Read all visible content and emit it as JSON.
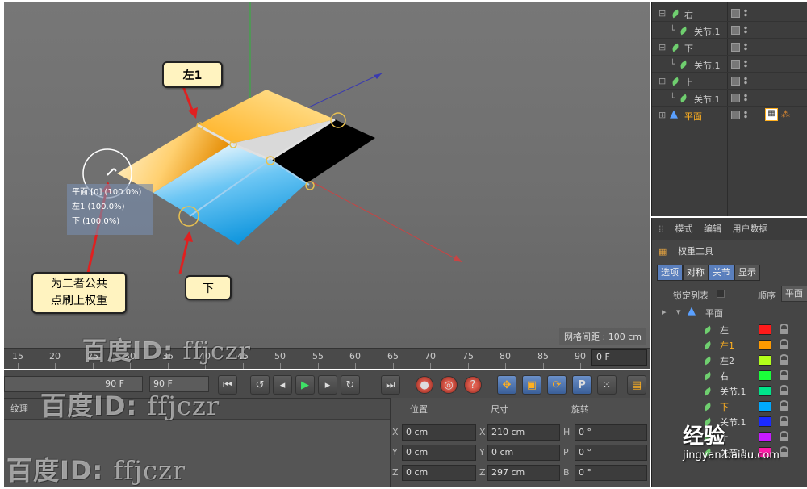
{
  "viewport": {
    "callout_left1": "左1",
    "callout_bottom": "下",
    "callout_note_line1": "为二者公共",
    "callout_note_line2": "点刷上权重",
    "tooltip_lines": [
      "平面.[0] (100.0%)",
      "左1 (100.0%)",
      "下 (100.0%)"
    ],
    "grid_spacing": "网格间距 : 100 cm"
  },
  "timeline": {
    "ticks": [
      "15",
      "20",
      "25",
      "30",
      "35",
      "40",
      "45",
      "50",
      "55",
      "60",
      "65",
      "70",
      "75",
      "80",
      "85",
      "90"
    ],
    "frame": "0 F"
  },
  "transport": {
    "end_frame_field": "90 F",
    "max_frame_field": "90 F",
    "buttons": [
      "go-to-start",
      "rewind",
      "step-back",
      "play",
      "step-forward",
      "go-to-end",
      "loop"
    ],
    "record_buttons": [
      "record-keyframe",
      "auto-keyframe",
      "keyframe-selection"
    ],
    "key_buttons": [
      "move-key",
      "scale-key",
      "rotate-key",
      "param-key",
      "point-level"
    ]
  },
  "bottom_left": {
    "tab": "纹理"
  },
  "coords": {
    "head_position": "位置",
    "head_size": "尺寸",
    "head_rotation": "旋转",
    "rows": [
      {
        "axis": "X",
        "pos": "0 cm",
        "size_axis": "X",
        "size": "210 cm",
        "rot_axis": "H",
        "rot": "0 °"
      },
      {
        "axis": "Y",
        "pos": "0 cm",
        "size_axis": "Y",
        "size": "0 cm",
        "rot_axis": "P",
        "rot": "0 °"
      },
      {
        "axis": "Z",
        "pos": "0 cm",
        "size_axis": "Z",
        "size": "297 cm",
        "rot_axis": "B",
        "rot": "0 °"
      }
    ]
  },
  "object_manager": {
    "rows": [
      {
        "name": "右",
        "type": "joint"
      },
      {
        "name": "关节.1",
        "type": "joint-child"
      },
      {
        "name": "下",
        "type": "joint"
      },
      {
        "name": "关节.1",
        "type": "joint-child"
      },
      {
        "name": "上",
        "type": "joint"
      },
      {
        "name": "关节.1",
        "type": "joint-child"
      },
      {
        "name": "平面",
        "type": "plane"
      }
    ]
  },
  "attributes": {
    "menu": [
      "模式",
      "编辑",
      "用户数据"
    ],
    "title": "权重工具",
    "tabs": [
      "选项",
      "对称",
      "关节",
      "显示"
    ],
    "lock_list_label": "锁定列表",
    "order_label": "顺序",
    "order_value": "平面",
    "root": "平面",
    "weights": [
      {
        "name": "左",
        "color": "#ff1a1a"
      },
      {
        "name": "左1",
        "color": "#ff9a00"
      },
      {
        "name": "左2",
        "color": "#b2ff1a"
      },
      {
        "name": "右",
        "color": "#1aff3a"
      },
      {
        "name": "关节.1",
        "color": "#00e58a"
      },
      {
        "name": "下",
        "color": "#00aaff"
      },
      {
        "name": "关节.1",
        "color": "#1a2aff"
      },
      {
        "name": "上",
        "color": "#c81aff"
      },
      {
        "name": "关节.1",
        "color": "#ff1aa8"
      }
    ]
  },
  "watermarks": {
    "text_cn": "百度ID: ",
    "text_id": "ffjczr",
    "brand_line1": "经验",
    "brand_line2": "jingyan.baidu.com"
  },
  "colors": {
    "accent_orange": "#e8a020",
    "accent_blue": "#1aa0e8",
    "tab_active": "#5a7fbd",
    "callout_arrow": "#e02020"
  }
}
